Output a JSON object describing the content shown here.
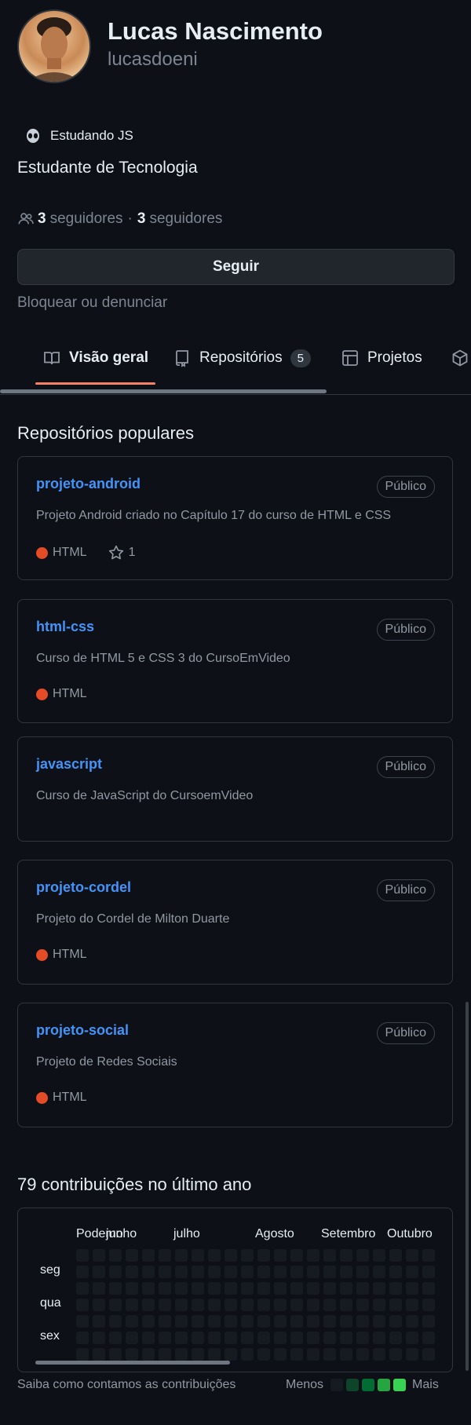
{
  "profile": {
    "name": "Lucas Nascimento",
    "login": "lucasdoeni",
    "status_text": "Estudando JS",
    "status_icon": "alien-icon",
    "bio": "Estudante de Tecnologia",
    "followers_count": "3",
    "followers_label": "seguidores",
    "following_count": "3",
    "following_label": "seguidores",
    "separator": "·",
    "follow_button": "Seguir",
    "block_link": "Bloquear ou denunciar"
  },
  "tabs": [
    {
      "label": "Visão geral",
      "icon": "book-icon",
      "active": true
    },
    {
      "label": "Repositórios",
      "icon": "repo-icon",
      "counter": "5"
    },
    {
      "label": "Projetos",
      "icon": "table-icon"
    },
    {
      "label": "",
      "icon": "package-icon"
    }
  ],
  "popular": {
    "title": "Repositórios populares",
    "repos": [
      {
        "name": "projeto-android",
        "visibility": "Público",
        "description": "Projeto Android criado no Capítulo 17 do curso de HTML e CSS",
        "language": "HTML",
        "stars": "1"
      },
      {
        "name": "html-css",
        "visibility": "Público",
        "description": "Curso de HTML 5 e CSS 3 do CursoEmVideo",
        "language": "HTML"
      },
      {
        "name": "javascript",
        "visibility": "Público",
        "description": "Curso de JavaScript do CursoemVideo"
      },
      {
        "name": "projeto-cordel",
        "visibility": "Público",
        "description": "Projeto do Cordel de Milton Duarte",
        "language": "HTML"
      },
      {
        "name": "projeto-social",
        "visibility": "Público",
        "description": "Projeto de Redes Sociais",
        "language": "HTML"
      }
    ]
  },
  "contributions": {
    "title": "79 contribuições no último ano",
    "months": [
      "Podemo",
      "junho",
      "julho",
      "Agosto",
      "Setembro",
      "Outubro"
    ],
    "days": [
      "seg",
      "qua",
      "sex"
    ],
    "learn_link": "Saiba como contamos as contribuições",
    "legend_less": "Menos",
    "legend_more": "Mais",
    "legend_colors": [
      "#161b22",
      "#0e4429",
      "#006d32",
      "#26a641",
      "#39d353"
    ],
    "cell_color": "#161b22",
    "weeks_visible": 22,
    "days_per_week": 7
  },
  "colors": {
    "background": "#0d1117",
    "link": "#4493f8",
    "tab_accent": "#f78166",
    "html_language": "#e34c26"
  }
}
